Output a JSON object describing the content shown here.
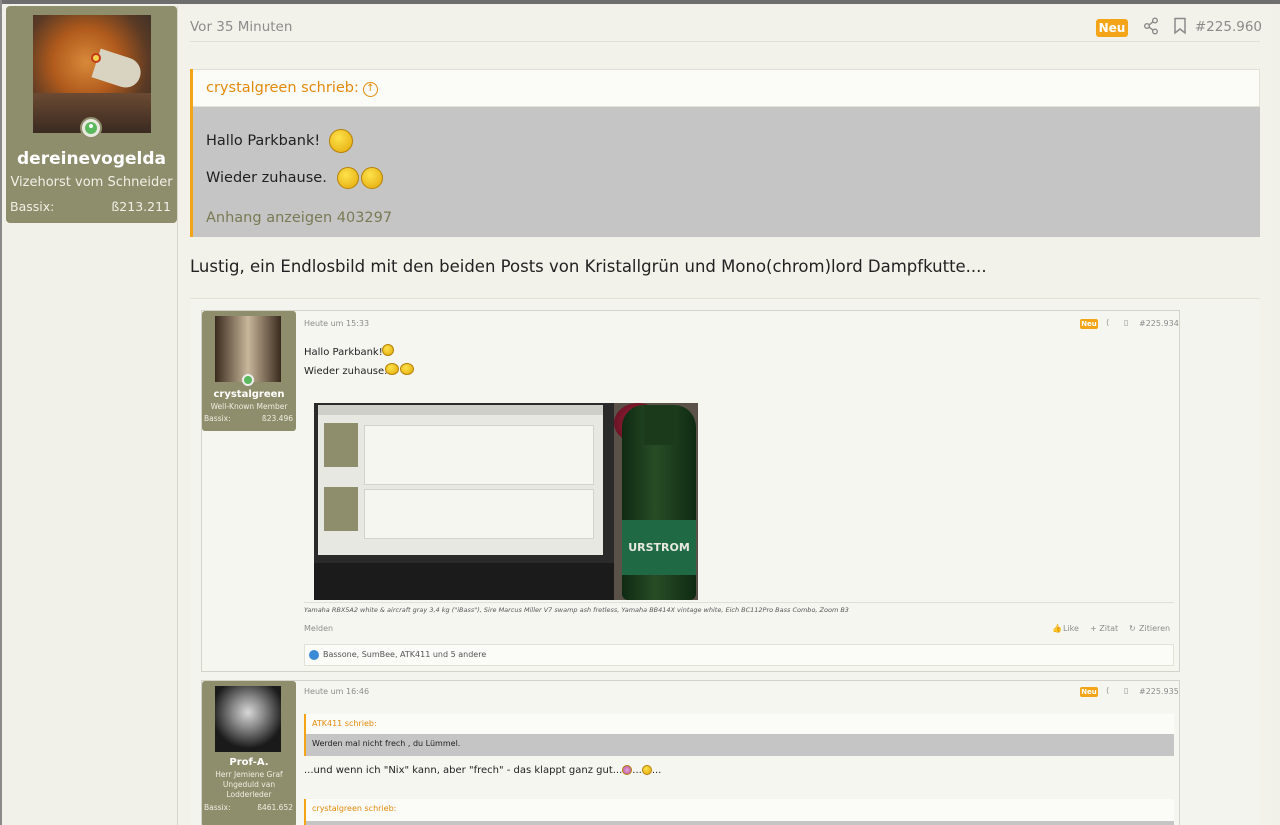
{
  "author": {
    "name": "dereinevogelda",
    "title": "Vizehorst vom Schneider",
    "stat_label": "Bassix:",
    "stat_value": "ß213.211"
  },
  "post": {
    "time": "Vor 35 Minuten",
    "badge": "Neu",
    "number": "#225.960",
    "quote": {
      "author": "crystalgreen schrieb:",
      "lines": [
        "Hallo Parkbank!",
        "Wieder zuhause."
      ],
      "attachment": "Anhang anzeigen 403297"
    },
    "text": "Lustig, ein Endlosbild mit den beiden Posts von Kristallgrün und Mono(chrom)lord Dampfkutte...."
  },
  "embedded": {
    "post1": {
      "time": "Heute um 15:33",
      "badge": "Neu",
      "number": "#225.934",
      "user": "crystalgreen",
      "user_title": "Well-Known Member",
      "stat_label": "Bassix:",
      "stat_value": "ß23.496",
      "line1": "Hallo Parkbank!",
      "line2": "Wieder zuhause.",
      "bottle_brand": "URSTROM",
      "signature": "Yamaha RBX5A2 white & aircraft gray 3,4 kg (\"iBass\"), Sire Marcus Miller V7 swamp ash fretless, Yamaha BB414X vintage white, Eich BC112Pro Bass Combo, Zoom B3",
      "report": "Melden",
      "like": "Like",
      "zitat": "+ Zitat",
      "zitieren": "Zitieren",
      "reactions": "Bassone, SumBee, ATK411 und 5 andere"
    },
    "post2": {
      "time": "Heute um 16:46",
      "badge": "Neu",
      "number": "#225.935",
      "user": "Prof-A.",
      "user_title_1": "Herr Jemiene Graf",
      "user_title_2": "Ungeduld van",
      "user_title_3": "Lodderleder",
      "stat_label": "Bassix:",
      "stat_value": "ß461.652",
      "quote1_author": "ATK411 schrieb:",
      "quote1_text": "Werden mal nicht frech , du Lümmel.",
      "text": "...und wenn ich \"Nix\" kann, aber \"frech\" - das klappt ganz gut...",
      "text_end": "...",
      "quote2_author": "crystalgreen schrieb:"
    }
  },
  "colors": {
    "accent": "#f3a417",
    "card": "#8f8e6c",
    "quote_author": "#e38a0a"
  },
  "icons": [
    "share-icon",
    "bookmark-icon",
    "arrow-up-circle-icon",
    "online-icon",
    "like-icon"
  ]
}
